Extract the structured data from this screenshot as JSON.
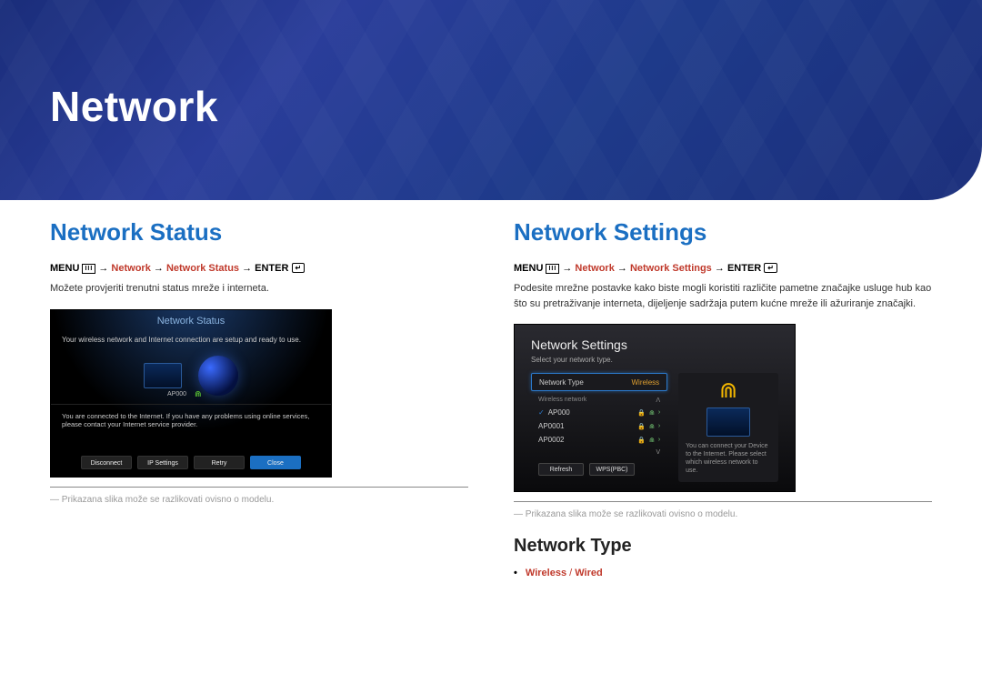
{
  "header": {
    "title": "Network"
  },
  "left": {
    "section_title": "Network Status",
    "crumb": {
      "menu": "MENU",
      "p1": "Network",
      "p2": "Network Status",
      "enter": "ENTER"
    },
    "desc": "Možete provjeriti trenutni status mreže i interneta.",
    "caption": "Prikazana slika može se razlikovati ovisno o modelu.",
    "shot": {
      "titlebar": "Network Status",
      "msg1": "Your wireless network and Internet connection are setup and ready to use.",
      "ap": "AP000",
      "msg2": "You are connected to the Internet. If you have any problems using online services, please contact your Internet service provider.",
      "buttons": [
        "Disconnect",
        "IP Settings",
        "Retry",
        "Close"
      ]
    }
  },
  "right": {
    "section_title": "Network Settings",
    "crumb": {
      "menu": "MENU",
      "p1": "Network",
      "p2": "Network Settings",
      "enter": "ENTER"
    },
    "desc": "Podesite mrežne postavke kako biste mogli koristiti različite pametne značajke usluge hub kao što su pretraživanje interneta, dijeljenje sadržaja putem kućne mreže ili ažuriranje značajki.",
    "caption": "Prikazana slika može se razlikovati ovisno o modelu.",
    "shot": {
      "title": "Network Settings",
      "subtitle": "Select your network type.",
      "row_label": "Network Type",
      "row_value": "Wireless",
      "group_label": "Wireless network",
      "aps": [
        "AP000",
        "AP0001",
        "AP0002"
      ],
      "side_text": "You can connect your Device to the Internet. Please select which wireless network to use.",
      "buttons": [
        "Refresh",
        "WPS(PBC)"
      ]
    },
    "subhead": "Network Type",
    "bullet": {
      "a": "Wireless",
      "sep": "/",
      "b": "Wired"
    }
  }
}
